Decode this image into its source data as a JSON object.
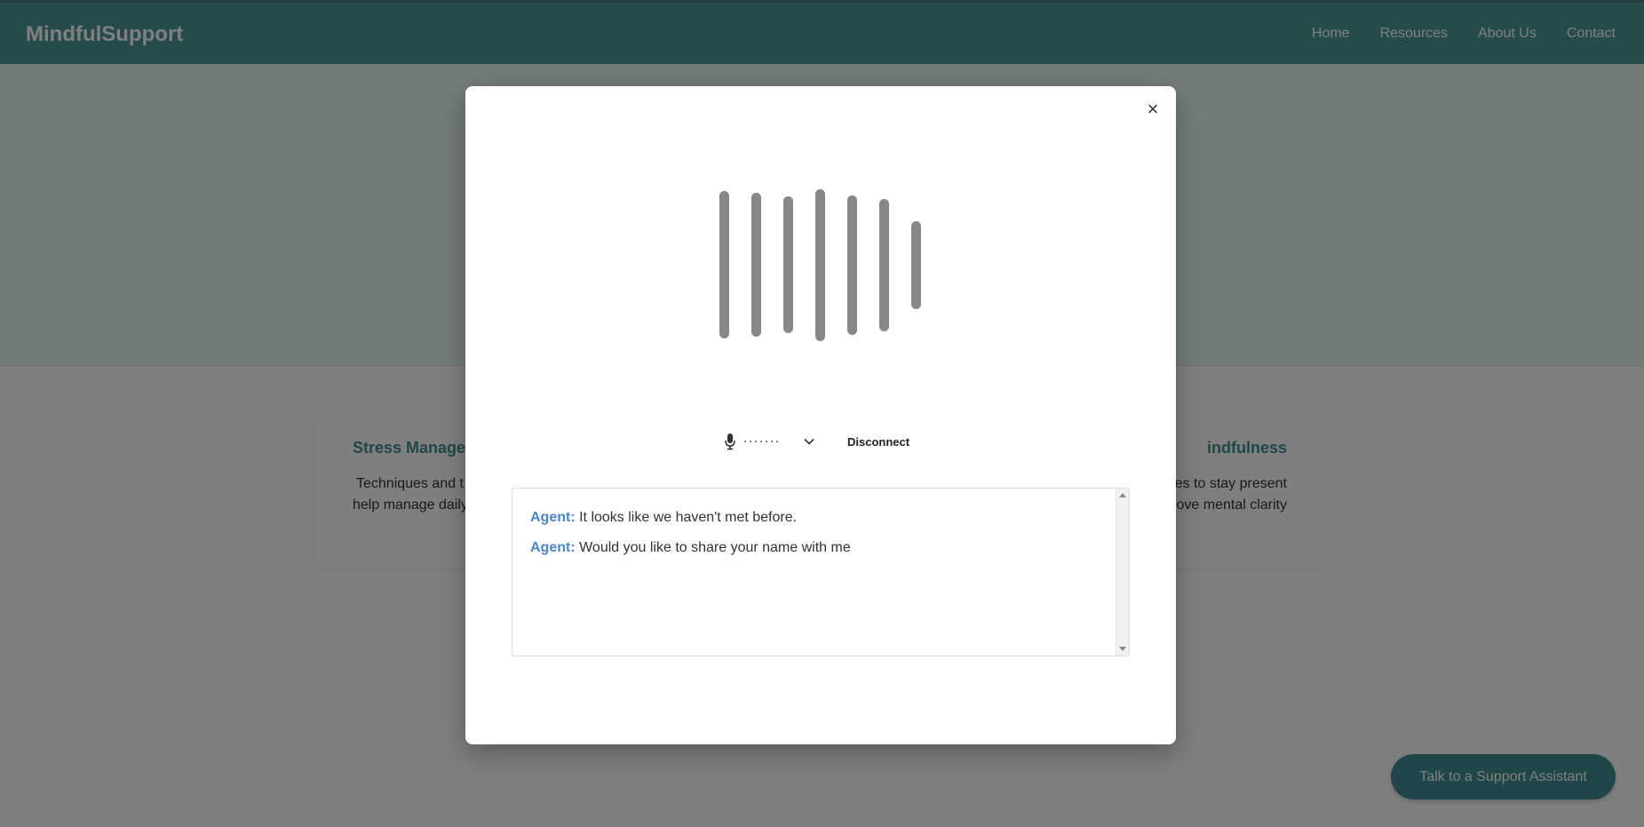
{
  "header": {
    "brand": "MindfulSupport",
    "nav": [
      "Home",
      "Resources",
      "About Us",
      "Contact"
    ]
  },
  "cards": [
    {
      "title": "Stress Manage",
      "text_line1": "Techniques and t",
      "text_line2": "help manage daily"
    },
    {
      "title": "indfulness",
      "text_line1": "es to stay present",
      "text_line2": "prove mental clarity"
    }
  ],
  "fab": {
    "label": "Talk to a Support Assistant"
  },
  "modal": {
    "close_glyph": "×",
    "audio_bar_levels": [
      0.97,
      0.95,
      0.9,
      1.0,
      0.92,
      0.87,
      0.58
    ],
    "controls": {
      "disconnect_label": "Disconnect"
    },
    "transcript": [
      {
        "speaker": "Agent:",
        "text": "It looks like we haven't met before."
      },
      {
        "speaker": "Agent:",
        "text": "Would you like to share your name with me"
      }
    ]
  },
  "colors": {
    "header_bg": "#4a9699",
    "accent": "#3f8f92",
    "agent_label": "#4a86d4",
    "audio_bar": "#888888"
  },
  "icons": {
    "mic": "microphone-icon",
    "chevron": "chevron-down-icon",
    "close": "close-icon"
  }
}
